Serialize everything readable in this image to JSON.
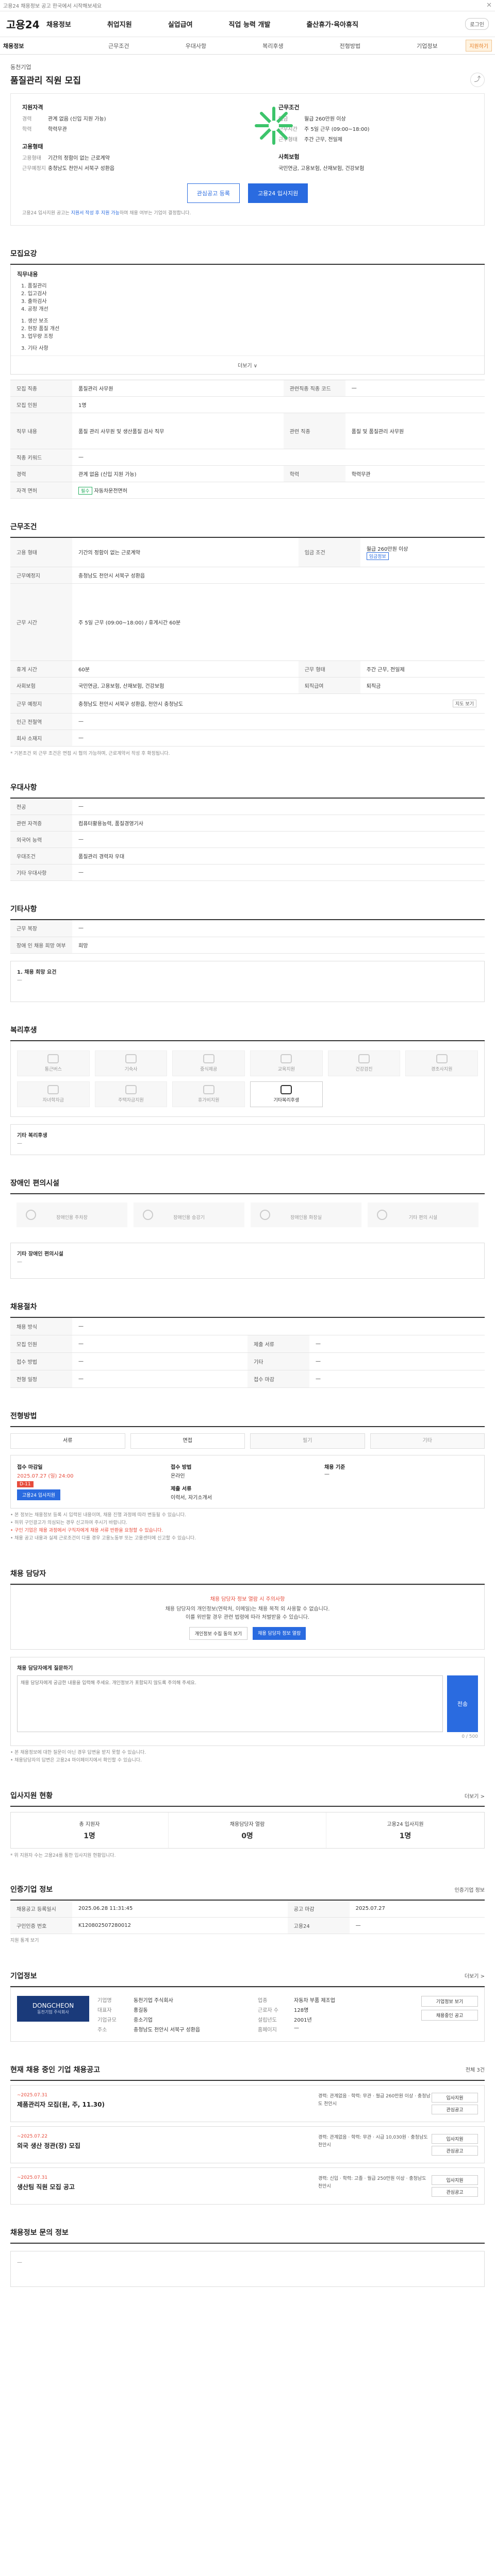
{
  "topbar": {
    "notice": "고용24 채용정보 공고 한국에서 시작해보세요",
    "close": "✕"
  },
  "header": {
    "logo": "고용24",
    "nav": [
      "채용정보",
      "취업지원",
      "실업급여",
      "직업 능력 개발",
      "출산휴가·육아휴직"
    ],
    "login": "로그인"
  },
  "subnav": [
    "채용정보",
    "근무조건",
    "우대사항",
    "복리후생",
    "전형방법",
    "기업정보"
  ],
  "subnav_apply": "지원하기",
  "job": {
    "company": "동천기업",
    "title": "품질관리 직원 모집",
    "share": "⤴"
  },
  "hero": {
    "left_title": "지원자격",
    "left_rows": [
      {
        "k": "경력",
        "v": "관계 없음 (신입 지원 가능)"
      },
      {
        "k": "학력",
        "v": "학력무관"
      }
    ],
    "left2_title": "고용형태",
    "left2_rows": [
      {
        "k": "고용형태",
        "v": "기간의 정함이 없는 근로계약"
      },
      {
        "k": "근무예정지",
        "v": "충청남도 천안시 서북구 성환읍"
      }
    ],
    "right_title": "근무조건",
    "right_rows": [
      {
        "k": "임금",
        "v": "월급 260만원 이상"
      },
      {
        "k": "근무시간",
        "v": "주 5일 근무 (09:00~18:00)"
      },
      {
        "k": "근무형태",
        "v": "주간 근무, 전일제"
      }
    ],
    "right2_title": "사회보험",
    "right2_rows": [
      {
        "k": "",
        "v": "국민연금, 고용보험, 산재보험, 건강보험"
      }
    ],
    "btn_interest": "관심공고 등록",
    "btn_apply": "고용24 입사지원",
    "note_prefix": "고용24 입사지원 공고는 ",
    "note_hl": "지원서 작성 후 지원 가능",
    "note_suffix": "하며 채용 여부는 기업이 결정합니다."
  },
  "duty": {
    "title": "모집요강",
    "sub": "직무내용",
    "items": [
      "1. 품질관리",
      "2. 입고검사",
      "3. 출하검사",
      "4. 공정 개선",
      "",
      "1. 생산 보조",
      "2. 현장 품질 개선",
      "3. 업무량 조정",
      "",
      "3. 기타 사항"
    ],
    "expand": "더보기 ∨",
    "rows": [
      {
        "th": "모집 직종",
        "td": "품질관리 사무원",
        "th2": "관련직종 직종 코드",
        "td2": "—"
      },
      {
        "th": "모집 인원",
        "td": "1명",
        "th2": "",
        "td2": ""
      },
      {
        "th": "직무 내용",
        "td": "품질 관리 사무원 및 생산품질 검사 직무",
        "th2": "관련 직종",
        "td2": "품질 및 품질관리 사무원"
      },
      {
        "th": "직종 키워드",
        "td": "—",
        "th2": "",
        "td2": ""
      },
      {
        "th": "경력",
        "td": "관계 없음 (신입 지원 가능)",
        "th2": "학력",
        "td2": "학력무관"
      },
      {
        "th": "자격 면허",
        "td": "자동차운전면허",
        "th2": "",
        "td2": ""
      }
    ],
    "tag1": "필수"
  },
  "cond": {
    "title": "근무조건",
    "rows": [
      {
        "th": "고용 형태",
        "td": "기간의 정함이 없는 근로계약",
        "th2": "임금 조건",
        "td2": "월급 260만원 이상"
      },
      {
        "th": "근무예정지",
        "td": "충청남도 천안시 서북구 성환읍",
        "th2": "",
        "td2": ""
      },
      {
        "th": "근무 시간",
        "td": "주 5일 근무 (09:00~18:00) / 휴게시간 60분",
        "th2": "",
        "td2": ""
      },
      {
        "th": "휴게 시간",
        "td": "60분",
        "th2": "근무 형태",
        "td2": "주간 근무, 전일제"
      },
      {
        "th": "사회보험",
        "td": "국민연금, 고용보험, 산재보험, 건강보험",
        "th2": "퇴직급여",
        "td2": "퇴직금"
      },
      {
        "th": "근무 예정지",
        "td": "충청남도 천안시 서북구 성환읍, 천안시 충청남도",
        "th2": "",
        "td2": ""
      },
      {
        "th": "인근 전철역",
        "td": "—",
        "th2": "",
        "td2": ""
      },
      {
        "th": "회사 소재지",
        "td": "—",
        "th2": "",
        "td2": ""
      }
    ],
    "map_btn": "지도 보기",
    "wage_link": "임금정보",
    "note": "* 기본조건 외 근무 조건은 면접 시 협의 가능하며, 근로계약서 작성 후 확정됩니다."
  },
  "pref": {
    "title": "우대사항",
    "rows": [
      {
        "th": "전공",
        "td": "—"
      },
      {
        "th": "관련 자격증",
        "td": "컴퓨터활용능력, 품질경영기사"
      },
      {
        "th": "외국어 능력",
        "td": "—"
      },
      {
        "th": "우대조건",
        "td": "품질관리 경력자 우대"
      },
      {
        "th": "기타 우대사항",
        "td": "—"
      }
    ]
  },
  "etc": {
    "title": "기타사항",
    "rows": [
      {
        "th": "근무 복장",
        "td": "—"
      },
      {
        "th": "장애 인 채용 희망 여부",
        "td": "희망"
      }
    ],
    "box_title": "1. 채용 희망 요건",
    "box_text": "—"
  },
  "welfare": {
    "title": "복리후생",
    "items": [
      "통근버스",
      "기숙사",
      "중식제공",
      "교육지원",
      "건강검진",
      "경조사지원",
      "자녀학자금",
      "주택자금지원",
      "휴가비지원",
      "기타복리후생"
    ],
    "active_index": 9,
    "box_title": "기타 복리후생",
    "box_text": "—"
  },
  "disabled": {
    "title": "장애인 편의시설",
    "items": [
      "장애인용 주차장",
      "장애인용 승강기",
      "장애인용 화장실",
      "기타 편의 시설"
    ],
    "box_title": "기타 장애인 편의시설",
    "box_text": "—"
  },
  "career": {
    "title": "채용절차",
    "rows": [
      {
        "th": "채용 방식",
        "td": "—",
        "th2": "",
        "td2": ""
      },
      {
        "th": "모집 인원",
        "td": "—",
        "th2": "제출 서류",
        "td2": "—"
      },
      {
        "th": "접수 방법",
        "td": "—",
        "th2": "기타",
        "td2": "—"
      },
      {
        "th": "전형 일정",
        "td": "—",
        "th2": "접수 마감",
        "td2": "—"
      }
    ]
  },
  "process": {
    "title": "전형방법",
    "tabs": [
      "서류",
      "면접",
      "필기",
      "기타"
    ],
    "active": [
      0,
      1
    ],
    "deadline_label": "접수 마감일",
    "deadline_value": "2025.07.27 (일) 24:00",
    "dday": "D-11",
    "apply_btn": "고용24 입사지원",
    "method_label": "접수 방법",
    "method_value": "온라인",
    "doc_label": "제출 서류",
    "doc_value": "이력서, 자기소개서",
    "etc_label": "채용 기준",
    "etc_value": "—"
  },
  "notes": {
    "lines": [
      "• 본 정보는 채용정보 등록 시 입력된 내용이며, 채용 진행 과정에 따라 변동될 수 있습니다.",
      "• 허위 구인광고가 의심되는 경우 신고하여 주시기 바랍니다.",
      "• 구인 기업은 채용 과정에서 구직자에게 채용 서류 반환을 요청할 수 있습니다.",
      "• 채용 공고 내용과 실제 근로조건이 다를 경우 고용노동부 또는 고용센터에 신고할 수 있습니다."
    ]
  },
  "manager": {
    "title": "채용 담당자",
    "warn": "채용 담당자 정보 열람 시 주의사항",
    "desc1": "채용 담당자의 개인정보(연락처, 이메일)는 채용 목적 외 사용할 수 없습니다.",
    "desc2": "이를 위반할 경우 관련 법령에 따라 처벌받을 수 있습니다.",
    "btn_out": "개인정보 수집 동의 보기",
    "btn_fill": "채용 담당자 정보 열람",
    "ask_label": "채용 담당자에게 질문하기",
    "ask_placeholder": "채용 담당자에게 궁금한 내용을 입력해 주세요. 개인정보가 포함되지 않도록 주의해 주세요.",
    "send": "전송",
    "counter": "0 / 500",
    "tips": [
      "• 본 채용정보에 대한 질문이 아닌 경우 답변을 받지 못할 수 있습니다.",
      "• 채용담당자의 답변은 고용24 마이페이지에서 확인할 수 있습니다."
    ]
  },
  "stats": {
    "title": "입사지원 현황",
    "more": "더보기 >",
    "items": [
      {
        "label": "총 지원자",
        "value": "1명"
      },
      {
        "label": "채용담당자 열람",
        "value": "0명"
      },
      {
        "label": "고용24 입사지원",
        "value": "1명"
      }
    ],
    "note": "* 위 지원자 수는 고용24를 통한 입사지원 현황입니다."
  },
  "record": {
    "title": "인증기업 정보",
    "btn": "인증기업 정보",
    "rows": [
      {
        "th": "채용공고 등록일시",
        "td": "2025.06.28 11:31:45",
        "th2": "공고 마감",
        "td2": "2025.07.27"
      },
      {
        "th": "구인인증 번호",
        "td": "K120802507280012",
        "th2": "고용24",
        "td2": "—"
      }
    ],
    "more": "지원 통계 보기"
  },
  "company": {
    "title": "기업정보",
    "more": "더보기 >",
    "logo_main": "DONGCHEON",
    "logo_sub": "동천기업 주식회사",
    "info": [
      {
        "k": "기업명",
        "v": "동천기업 주식회사"
      },
      {
        "k": "업종",
        "v": "자동차 부품 제조업"
      },
      {
        "k": "대표자",
        "v": "홍길동"
      },
      {
        "k": "근로자 수",
        "v": "128명"
      },
      {
        "k": "기업규모",
        "v": "중소기업"
      },
      {
        "k": "설립년도",
        "v": "2001년"
      },
      {
        "k": "주소",
        "v": "충청남도 천안시 서북구 성환읍"
      },
      {
        "k": "홈페이지",
        "v": "—"
      }
    ],
    "side": [
      "기업정보 보기",
      "채용중인 공고"
    ]
  },
  "others": {
    "title": "현재 채용 중인 기업 채용공고",
    "count": "전체 3건",
    "items": [
      {
        "date": "~2025.07.31",
        "title": "제품관리자 모집(원, 주, 11.30)",
        "mid": "경력: 관계없음 · 학력: 무관 · 월급 260만원 이상 · 충청남도 천안시",
        "btn1": "입사지원",
        "btn2": "관심공고"
      },
      {
        "date": "~2025.07.22",
        "title": "외국 생산 정관(장) 모집",
        "mid": "경력: 관계없음 · 학력: 무관 · 시급 10,030원 · 충청남도 천안시",
        "btn1": "입사지원",
        "btn2": "관심공고"
      },
      {
        "date": "~2025.07.31",
        "title": "생산팀 직원 모집 공고",
        "mid": "경력: 신입 · 학력: 고졸 · 월급 250만원 이상 · 충청남도 천안시",
        "btn1": "입사지원",
        "btn2": "관심공고"
      }
    ]
  },
  "bottom": {
    "title": "채용정보 문의 정보",
    "text": "—"
  }
}
